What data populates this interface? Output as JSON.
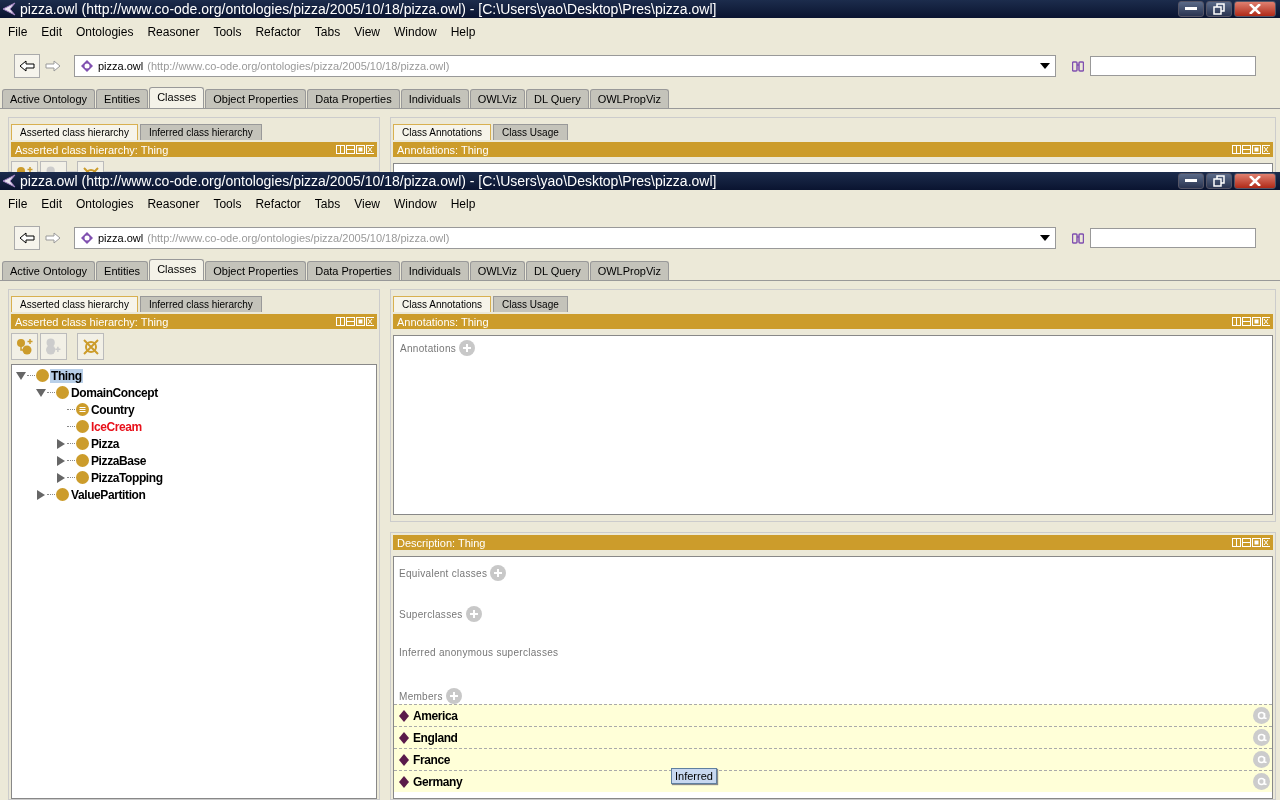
{
  "windows": [
    {
      "title": "pizza.owl (http://www.co-ode.org/ontologies/pizza/2005/10/18/pizza.owl) - [C:\\Users\\yao\\Desktop\\Pres\\pizza.owl]",
      "menu": [
        "File",
        "Edit",
        "Ontologies",
        "Reasoner",
        "Tools",
        "Refactor",
        "Tabs",
        "View",
        "Window",
        "Help"
      ],
      "ontology": {
        "name": "pizza.owl",
        "iri": "(http://www.co-ode.org/ontologies/pizza/2005/10/18/pizza.owl)"
      },
      "tabs": [
        {
          "label": "Active Ontology",
          "selected": false
        },
        {
          "label": "Entities",
          "selected": false
        },
        {
          "label": "Classes",
          "selected": true
        },
        {
          "label": "Object Properties",
          "selected": false
        },
        {
          "label": "Data Properties",
          "selected": false
        },
        {
          "label": "Individuals",
          "selected": false
        },
        {
          "label": "OWLViz",
          "selected": false
        },
        {
          "label": "DL Query",
          "selected": false
        },
        {
          "label": "OWLPropViz",
          "selected": false
        }
      ],
      "hierarchy_tabs": [
        {
          "label": "Asserted class hierarchy",
          "selected": true
        },
        {
          "label": "Inferred class hierarchy",
          "selected": false
        }
      ],
      "hierarchy_title": "Asserted class hierarchy: Thing",
      "annotation_tabs": [
        {
          "label": "Class Annotations",
          "selected": true
        },
        {
          "label": "Class Usage",
          "selected": false
        }
      ],
      "annotations_title": "Annotations: Thing"
    },
    {
      "title": "pizza.owl (http://www.co-ode.org/ontologies/pizza/2005/10/18/pizza.owl) - [C:\\Users\\yao\\Desktop\\Pres\\pizza.owl]",
      "menu": [
        "File",
        "Edit",
        "Ontologies",
        "Reasoner",
        "Tools",
        "Refactor",
        "Tabs",
        "View",
        "Window",
        "Help"
      ],
      "ontology": {
        "name": "pizza.owl",
        "iri": "(http://www.co-ode.org/ontologies/pizza/2005/10/18/pizza.owl)"
      },
      "tabs": [
        {
          "label": "Active Ontology",
          "selected": false
        },
        {
          "label": "Entities",
          "selected": false
        },
        {
          "label": "Classes",
          "selected": true
        },
        {
          "label": "Object Properties",
          "selected": false
        },
        {
          "label": "Data Properties",
          "selected": false
        },
        {
          "label": "Individuals",
          "selected": false
        },
        {
          "label": "OWLViz",
          "selected": false
        },
        {
          "label": "DL Query",
          "selected": false
        },
        {
          "label": "OWLPropViz",
          "selected": false
        }
      ],
      "hierarchy_tabs": [
        {
          "label": "Asserted class hierarchy",
          "selected": true
        },
        {
          "label": "Inferred class hierarchy",
          "selected": false
        }
      ],
      "hierarchy_title": "Asserted class hierarchy: Thing",
      "tree": [
        {
          "label": "Thing",
          "kind": "primitive",
          "selected": true,
          "unsatisfiable": false,
          "expanded": true,
          "children": [
            {
              "label": "DomainConcept",
              "kind": "primitive",
              "selected": false,
              "unsatisfiable": false,
              "expanded": true,
              "children": [
                {
                  "label": "Country",
                  "kind": "defined",
                  "selected": false,
                  "unsatisfiable": false
                },
                {
                  "label": "IceCream",
                  "kind": "primitive",
                  "selected": false,
                  "unsatisfiable": true
                },
                {
                  "label": "Pizza",
                  "kind": "primitive",
                  "selected": false,
                  "unsatisfiable": false,
                  "expanded": false
                },
                {
                  "label": "PizzaBase",
                  "kind": "primitive",
                  "selected": false,
                  "unsatisfiable": false,
                  "expanded": false
                },
                {
                  "label": "PizzaTopping",
                  "kind": "primitive",
                  "selected": false,
                  "unsatisfiable": false,
                  "expanded": false
                }
              ]
            },
            {
              "label": "ValuePartition",
              "kind": "primitive",
              "selected": false,
              "unsatisfiable": false,
              "expanded": false
            }
          ]
        }
      ],
      "annotation_tabs": [
        {
          "label": "Class Annotations",
          "selected": true
        },
        {
          "label": "Class Usage",
          "selected": false
        }
      ],
      "annotations_title": "Annotations: Thing",
      "annotations_label": "Annotations",
      "description_title": "Description: Thing",
      "sections": [
        {
          "label": "Equivalent classes",
          "add": true
        },
        {
          "label": "Superclasses",
          "add": true
        },
        {
          "label": "Inferred anonymous superclasses",
          "add": false
        },
        {
          "label": "Members",
          "add": true
        }
      ],
      "members": [
        {
          "name": "America"
        },
        {
          "name": "England"
        },
        {
          "name": "France"
        },
        {
          "name": "Germany"
        }
      ],
      "tooltip": "Inferred"
    }
  ]
}
